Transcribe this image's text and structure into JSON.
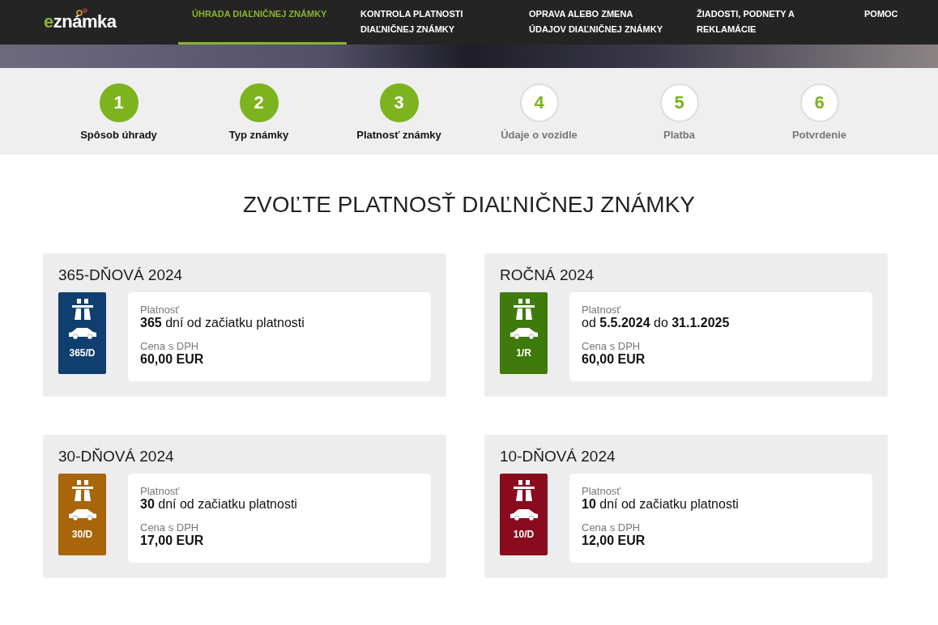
{
  "logo": {
    "prefix": "e",
    "rest": "známka"
  },
  "nav": [
    {
      "label": "ÚHRADA DIAĽNIČNEJ ZNÁMKY",
      "selected": true
    },
    {
      "label": "KONTROLA PLATNOSTI DIAĽNIČNEJ ZNÁMKY",
      "selected": false
    },
    {
      "label": "OPRAVA ALEBO ZMENA ÚDAJOV DIAĽNIČNEJ ZNÁMKY",
      "selected": false
    },
    {
      "label": "ŽIADOSTI, PODNETY A REKLAMÁCIE",
      "selected": false
    },
    {
      "label": "POMOC",
      "selected": false
    }
  ],
  "steps": [
    {
      "number": "1",
      "label": "Spôsob úhrady",
      "done": true
    },
    {
      "number": "2",
      "label": "Typ známky",
      "done": true
    },
    {
      "number": "3",
      "label": "Platnosť známky",
      "done": true
    },
    {
      "number": "4",
      "label": "Údaje o vozidle",
      "done": false
    },
    {
      "number": "5",
      "label": "Platba",
      "done": false
    },
    {
      "number": "6",
      "label": "Potvrdenie",
      "done": false
    }
  ],
  "heading": "ZVOĽTE PLATNOSŤ DIAĽNIČNEJ ZNÁMKY",
  "options": [
    {
      "title": "365-DŇOVÁ 2024",
      "code": "365/D",
      "color": "#0f3f6e",
      "validity_label": "Platnosť",
      "validity": "**365** dní od začiatku platnosti",
      "price_label": "Cena s DPH",
      "price": "60,00 EUR"
    },
    {
      "title": "ROČNÁ 2024",
      "code": "1/R",
      "color": "#3f7a0c",
      "validity_label": "Platnosť",
      "validity": "od **5.5.2024** do **31.1.2025**",
      "price_label": "Cena s DPH",
      "price": "60,00 EUR"
    },
    {
      "title": "30-DŇOVÁ 2024",
      "code": "30/D",
      "color": "#a8650a",
      "validity_label": "Platnosť",
      "validity": "**30** dní od začiatku platnosti",
      "price_label": "Cena s DPH",
      "price": "17,00 EUR"
    },
    {
      "title": "10-DŇOVÁ 2024",
      "code": "10/D",
      "color": "#8a0a1e",
      "validity_label": "Platnosť",
      "validity": "**10** dní od začiatku platnosti",
      "price_label": "Cena s DPH",
      "price": "12,00 EUR"
    }
  ]
}
